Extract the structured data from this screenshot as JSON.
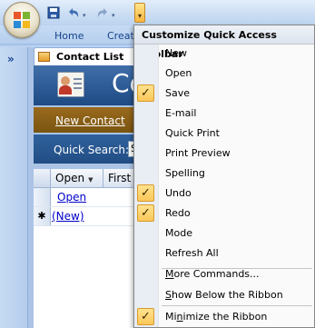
{
  "ribbon": {
    "tabs": [
      "Home",
      "Create"
    ]
  },
  "qat": {
    "save_icon": "save-icon",
    "undo_icon": "undo-icon",
    "redo_icon": "redo-icon"
  },
  "nav": {
    "toggle_glyph": "»"
  },
  "document": {
    "tab_label": "Contact List",
    "banner_title": "Co",
    "new_contact": "New Contact",
    "search_label": "Quick Search:",
    "search_value": "S",
    "columns": [
      "Open",
      "First N"
    ],
    "rows": [
      {
        "selector": "",
        "link": "Open"
      },
      {
        "selector": "✱",
        "link": "(New)"
      }
    ]
  },
  "menu": {
    "header": "Customize Quick Access Toolbar",
    "items": [
      {
        "label": "New",
        "checked": false
      },
      {
        "label": "Open",
        "checked": false
      },
      {
        "label": "Save",
        "checked": true
      },
      {
        "label": "E-mail",
        "checked": false
      },
      {
        "label": "Quick Print",
        "checked": false
      },
      {
        "label": "Print Preview",
        "checked": false
      },
      {
        "label": "Spelling",
        "checked": false
      },
      {
        "label": "Undo",
        "checked": true
      },
      {
        "label": "Redo",
        "checked": true
      },
      {
        "label": "Mode",
        "checked": false
      },
      {
        "label": "Refresh All",
        "checked": false
      }
    ],
    "more_commands": {
      "prefix": "M",
      "rest": "ore Commands..."
    },
    "show_below": {
      "prefix": "S",
      "rest": "how Below the Ribbon"
    },
    "minimize": {
      "pre": "Mi",
      "u": "n",
      "rest": "imize the Ribbon",
      "checked": true
    },
    "check_glyph": "✓"
  },
  "colors": {
    "accent": "#ffd26b",
    "banner": "#2c5a94",
    "new_contact_bar": "#8a5f16"
  }
}
